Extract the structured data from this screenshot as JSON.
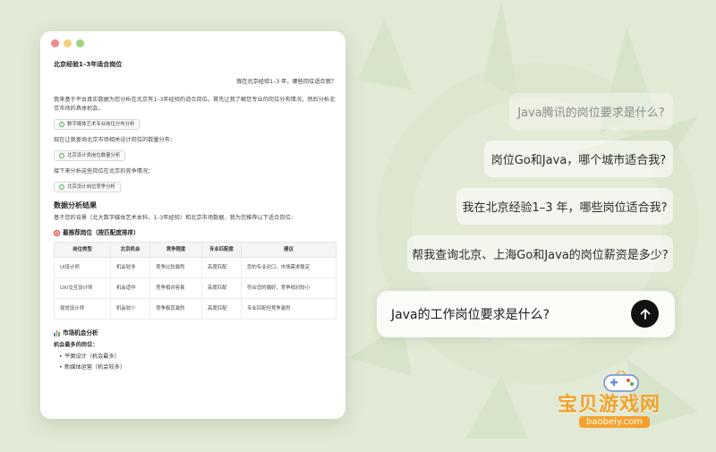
{
  "window": {
    "title": "北京经验1–3年适合岗位",
    "user_question": "我在北京经验1–3 年，哪些岗位适合我？",
    "intro": "我来基于平台真实数据为您分析在北京有1–3年经验的适合岗位。首先让我了解您专业的岗位分布情况，然后分析北京市场的具体机会。",
    "tool1": "数字媒体艺术专业岗位分布分析",
    "step2": "现在让我查询北京市场相关设计岗位的数量分布：",
    "tool2": "北京设计类岗位数量分析",
    "step3": "接下来分析这些岗位在北京的竞争情况：",
    "tool3": "北京设计岗位竞争分析",
    "result_heading": "数据分析结果",
    "result_intro": "基于您的背景（北大数字媒体艺术本科，1–3年经验）和北京市场数据，我为您推荐以下适合岗位：",
    "recommend_heading": "最推荐岗位（按匹配度排序）",
    "table": {
      "headers": [
        "岗位类型",
        "北京机会",
        "竞争程度",
        "专业匹配度",
        "建议"
      ],
      "rows": [
        [
          "UI设计师",
          "机会较多",
          "竞争比较激烈",
          "高度匹配",
          "您的专业对口，市场需求稳定"
        ],
        [
          "UX/交互设计师",
          "机会适中",
          "竞争相对容易",
          "高度匹配",
          "符合您的偏好，竞争相对较小"
        ],
        [
          "视觉设计师",
          "机会较少",
          "竞争极其激烈",
          "高度匹配",
          "专业匹配但竞争激烈"
        ]
      ]
    },
    "market_heading": "市场机会分析",
    "most_opportunity": "机会最多的岗位：",
    "bullets": [
      "平面设计（机会最多）",
      "新媒体运营（机会较多）"
    ]
  },
  "suggestions": [
    "Java腾讯的岗位要求是什么?",
    "岗位Go和Java，哪个城市适合我?",
    "我在北京经验1–3 年，哪些岗位适合我?",
    "帮我查询北京、上海Go和Java的岗位薪资是多少?"
  ],
  "input": {
    "value": "Java的工作岗位要求是什么?"
  },
  "watermark": {
    "name": "宝贝游戏网",
    "url": "baobeiy.com"
  },
  "colors": {
    "background": "#e2ead6",
    "send_button": "#111111",
    "watermark_orange": "#f0a22a"
  }
}
